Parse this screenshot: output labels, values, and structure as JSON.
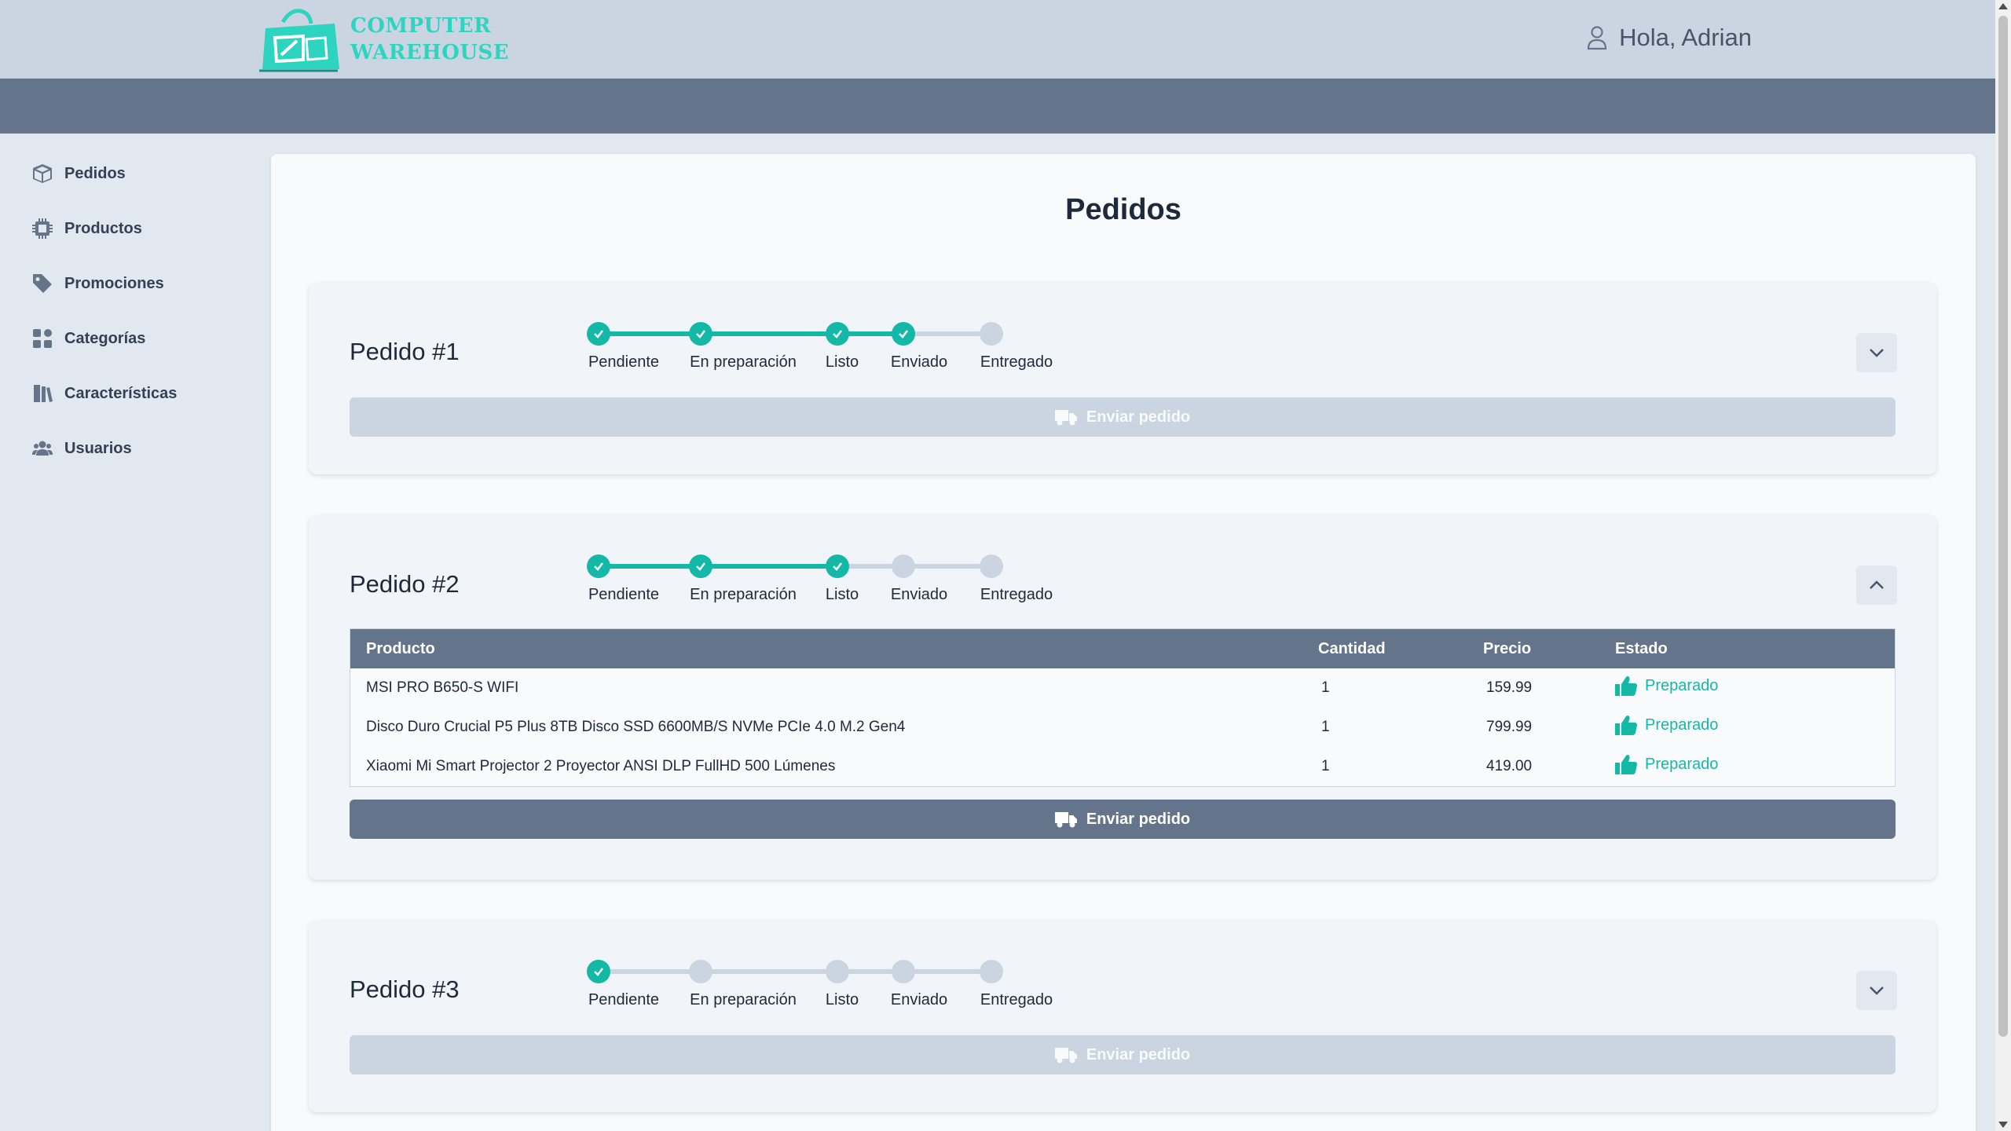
{
  "header": {
    "logo_line1": "COMPUTER",
    "logo_line2": "WAREHOUSE",
    "greeting": "Hola, Adrian"
  },
  "sidebar": {
    "items": [
      {
        "label": "Pedidos",
        "icon": "box-icon"
      },
      {
        "label": "Productos",
        "icon": "chip-icon"
      },
      {
        "label": "Promociones",
        "icon": "tag-icon"
      },
      {
        "label": "Categorías",
        "icon": "grid-icon"
      },
      {
        "label": "Características",
        "icon": "book-icon"
      },
      {
        "label": "Usuarios",
        "icon": "users-icon"
      }
    ]
  },
  "main": {
    "title": "Pedidos",
    "steps": [
      "Pendiente",
      "En preparación",
      "Listo",
      "Enviado",
      "Entregado"
    ],
    "send_label": "Enviar pedido",
    "orders": [
      {
        "title": "Pedido #1",
        "completed_steps": 4,
        "expanded": false
      },
      {
        "title": "Pedido #2",
        "completed_steps": 3,
        "expanded": true
      },
      {
        "title": "Pedido #3",
        "completed_steps": 1,
        "expanded": false
      }
    ],
    "table": {
      "headers": [
        "Producto",
        "Cantidad",
        "Precio",
        "Estado"
      ],
      "rows": [
        {
          "product": "MSI PRO B650-S WIFI",
          "qty": "1",
          "price": "159.99",
          "status": "Preparado"
        },
        {
          "product": "Disco Duro Crucial P5 Plus 8TB Disco SSD 6600MB/S NVMe PCIe 4.0 M.2 Gen4",
          "qty": "1",
          "price": "799.99",
          "status": "Preparado"
        },
        {
          "product": "Xiaomi Mi Smart Projector 2 Proyector ANSI DLP FullHD 500 Lúmenes",
          "qty": "1",
          "price": "419.00",
          "status": "Preparado"
        }
      ]
    }
  },
  "colors": {
    "accent": "#14b8a6",
    "header_bg": "#cbd5e1",
    "subbar_bg": "#64748b",
    "logo": "#2dd4bf"
  }
}
